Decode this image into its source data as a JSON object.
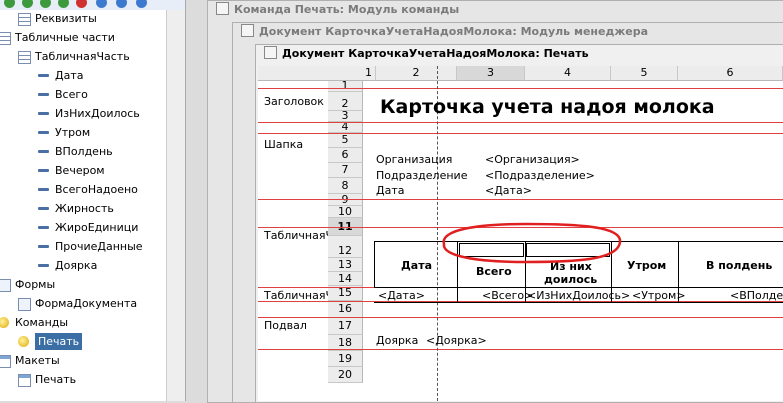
{
  "tree": {
    "items": [
      {
        "label": "Реквизиты",
        "icon": "table-icon",
        "indent": 1
      },
      {
        "label": "Табличные части",
        "icon": "table-icon",
        "indent": 0
      },
      {
        "label": "ТабличнаяЧасть",
        "icon": "table-icon",
        "indent": 1
      },
      {
        "label": "Дата",
        "icon": "field-icon",
        "indent": 2
      },
      {
        "label": "Всего",
        "icon": "field-icon",
        "indent": 2
      },
      {
        "label": "ИзНихДоилось",
        "icon": "field-icon",
        "indent": 2
      },
      {
        "label": "Утром",
        "icon": "field-icon",
        "indent": 2
      },
      {
        "label": "ВПолдень",
        "icon": "field-icon",
        "indent": 2
      },
      {
        "label": "Вечером",
        "icon": "field-icon",
        "indent": 2
      },
      {
        "label": "ВсегоНадоено",
        "icon": "field-icon",
        "indent": 2
      },
      {
        "label": "Жирность",
        "icon": "field-icon",
        "indent": 2
      },
      {
        "label": "ЖироЕдиници",
        "icon": "field-icon",
        "indent": 2
      },
      {
        "label": "ПрочиеДанные",
        "icon": "field-icon",
        "indent": 2
      },
      {
        "label": "Доярка",
        "icon": "field-icon",
        "indent": 2
      },
      {
        "label": "Формы",
        "icon": "form-icon",
        "indent": 0
      },
      {
        "label": "ФормаДокумента",
        "icon": "form-icon",
        "indent": 1
      },
      {
        "label": "Команды",
        "icon": "command-icon",
        "indent": 0
      },
      {
        "label": "Печать",
        "icon": "command-icon",
        "indent": 1,
        "selected": true
      },
      {
        "label": "Макеты",
        "icon": "layout-icon",
        "indent": 0
      },
      {
        "label": "Печать",
        "icon": "layout-icon",
        "indent": 1
      }
    ]
  },
  "windows": {
    "command_module": "Команда Печать: Модуль команды",
    "manager_module": "Документ КарточкаУчетаНадояМолока: Модуль менеджера",
    "print_layout": "Документ КарточкаУчетаНадояМолока: Печать"
  },
  "sheet": {
    "columns": [
      "1",
      "2",
      "3",
      "4",
      "5",
      "6"
    ],
    "rows": [
      "1",
      "2",
      "3",
      "4",
      "5",
      "6",
      "7",
      "8",
      "9",
      "10",
      "11",
      "12",
      "13",
      "14",
      "15",
      "16",
      "17",
      "18",
      "19",
      "20"
    ],
    "sections": {
      "header": "Заголовок",
      "cap": "Шапка",
      "tabular": "ТабличнаяЧасть",
      "tabular2": "ТабличнаяЧасть",
      "footer": "Подвал"
    },
    "title": "Карточка учета надоя молока",
    "cap_labels": {
      "org": "Организация",
      "dept": "Подразделение",
      "date": "Дата"
    },
    "cap_params": {
      "org": "<Организация>",
      "dept": "<Подразделение>",
      "date": "<Дата>"
    },
    "table_headers": {
      "date": "Дата",
      "total": "Всего",
      "milked_1": "Из них",
      "milked_2": "доилось",
      "morning": "Утром",
      "noon": "В полдень"
    },
    "table_params": {
      "date": "<Дата>",
      "total": "<Всего>",
      "milked": "<ИзНихДоилось>",
      "morning": "<Утром>",
      "noon": "<ВПолдень>"
    },
    "footer_label": "Доярка",
    "footer_param": "<Доярка>"
  }
}
